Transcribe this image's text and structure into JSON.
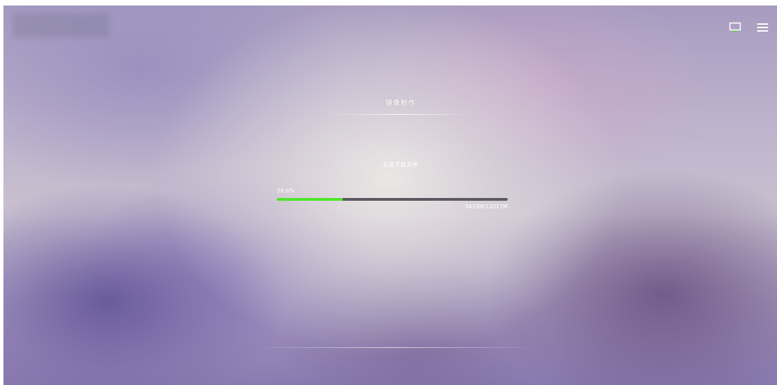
{
  "header": {
    "icons": [
      "monitor-icon",
      "menu-icon"
    ],
    "accent_color": "#4ee62b"
  },
  "dialog": {
    "title": "镜像制作",
    "status_text": "正在下载文件",
    "progress": {
      "percent_label": "28.6%",
      "fraction": 0.286,
      "size_label": "3433M/12017M",
      "fill_color": "#4ee62b",
      "track_color": "#5a5860"
    }
  }
}
